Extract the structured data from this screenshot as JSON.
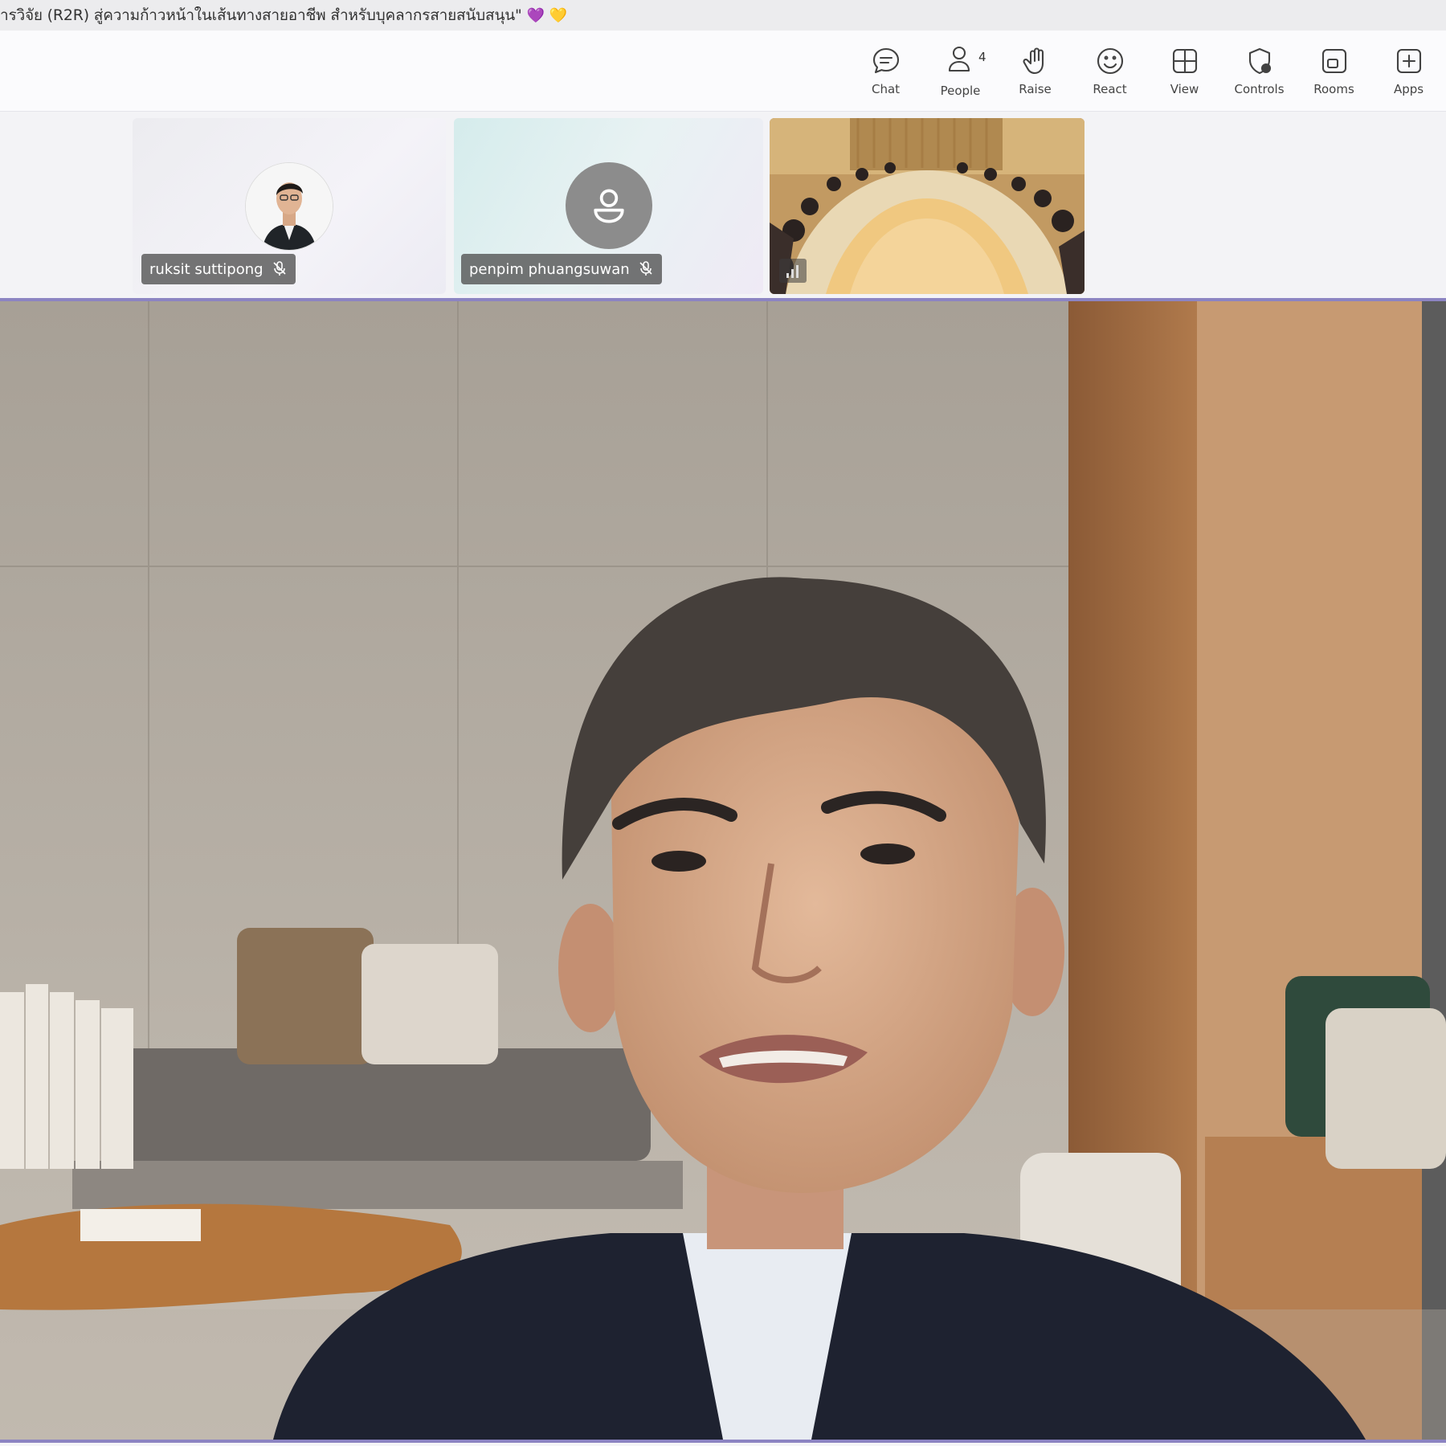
{
  "meeting": {
    "title": "ารวิจัย (R2R) สู่ความก้าวหน้าในเส้นทางสายอาชีพ สำหรับบุคลากรสายสนับสนุน\"",
    "title_emoji": "💜 💛"
  },
  "toolbar": {
    "items": [
      {
        "label": "Chat",
        "icon": "chat-icon"
      },
      {
        "label": "People",
        "icon": "people-icon",
        "badge": "4"
      },
      {
        "label": "Raise",
        "icon": "hand-icon"
      },
      {
        "label": "React",
        "icon": "smile-icon"
      },
      {
        "label": "View",
        "icon": "grid-icon"
      },
      {
        "label": "Controls",
        "icon": "controls-icon"
      },
      {
        "label": "Rooms",
        "icon": "rooms-icon"
      },
      {
        "label": "Apps",
        "icon": "plus-icon"
      }
    ]
  },
  "participants": [
    {
      "name": "ruksit suttipong",
      "muted": true
    },
    {
      "name": "penpim phuangsuwan",
      "muted": true
    },
    {
      "name": "",
      "type": "room-video"
    }
  ],
  "colors": {
    "accent": "#8c84c2",
    "tag_bg": "#505050"
  }
}
